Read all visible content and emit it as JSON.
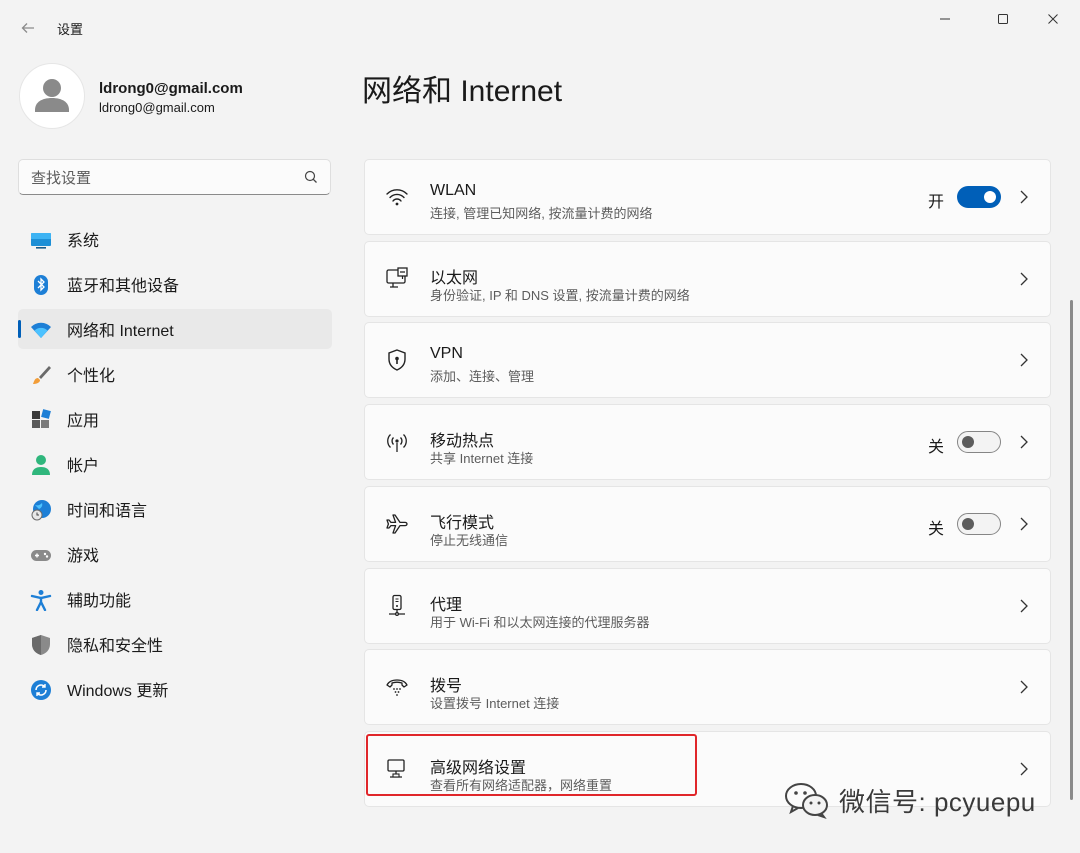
{
  "window": {
    "title": "设置"
  },
  "account": {
    "name": "ldrong0@gmail.com",
    "email": "ldrong0@gmail.com"
  },
  "search": {
    "placeholder": "查找设置"
  },
  "nav": {
    "items": [
      {
        "label": "系统",
        "icon": "monitor-icon"
      },
      {
        "label": "蓝牙和其他设备",
        "icon": "bluetooth-icon"
      },
      {
        "label": "网络和 Internet",
        "icon": "wifi-icon",
        "active": true
      },
      {
        "label": "个性化",
        "icon": "brush-icon"
      },
      {
        "label": "应用",
        "icon": "apps-icon"
      },
      {
        "label": "帐户",
        "icon": "person-icon"
      },
      {
        "label": "时间和语言",
        "icon": "globe-clock-icon"
      },
      {
        "label": "游戏",
        "icon": "gamepad-icon"
      },
      {
        "label": "辅助功能",
        "icon": "accessibility-icon"
      },
      {
        "label": "隐私和安全性",
        "icon": "shield-icon"
      },
      {
        "label": "Windows 更新",
        "icon": "update-icon"
      }
    ]
  },
  "main": {
    "title": "网络和 Internet",
    "cards": [
      {
        "title": "WLAN",
        "desc": "连接, 管理已知网络, 按流量计费的网络",
        "icon": "wifi-icon",
        "toggle": {
          "label": "开",
          "on": true
        }
      },
      {
        "title": "以太网",
        "desc": "身份验证, IP 和 DNS 设置, 按流量计费的网络",
        "icon": "ethernet-icon"
      },
      {
        "title": "VPN",
        "desc": "添加、连接、管理",
        "icon": "vpn-shield-icon"
      },
      {
        "title": "移动热点",
        "desc": "共享 Internet 连接",
        "icon": "hotspot-icon",
        "toggle": {
          "label": "关",
          "on": false
        }
      },
      {
        "title": "飞行模式",
        "desc": "停止无线通信",
        "icon": "airplane-icon",
        "toggle": {
          "label": "关",
          "on": false
        }
      },
      {
        "title": "代理",
        "desc": "用于 Wi-Fi 和以太网连接的代理服务器",
        "icon": "proxy-icon"
      },
      {
        "title": "拨号",
        "desc": "设置拨号 Internet 连接",
        "icon": "dialup-icon"
      },
      {
        "title": "高级网络设置",
        "desc": "查看所有网络适配器，网络重置",
        "icon": "advanced-network-icon"
      }
    ]
  },
  "watermark": {
    "text": "微信号: pcyuepu"
  },
  "colors": {
    "accent": "#005fb8",
    "highlight": "#e0262a",
    "background": "#f3f3f3",
    "card": "#fbfbfb"
  }
}
